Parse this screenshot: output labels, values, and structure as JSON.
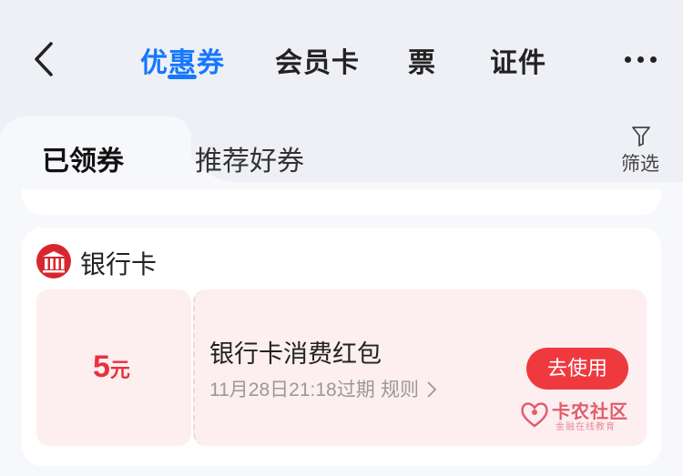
{
  "nav": {
    "tabs": [
      {
        "label": "优惠券",
        "active": true
      },
      {
        "label": "会员卡",
        "active": false
      },
      {
        "label": "票",
        "active": false
      },
      {
        "label": "证件",
        "active": false
      }
    ]
  },
  "subtabs": {
    "items": [
      {
        "label": "已领券",
        "active": true
      },
      {
        "label": "推荐好券",
        "active": false
      }
    ],
    "filter_label": "筛选"
  },
  "section": {
    "bank_name": "银行卡",
    "coupon": {
      "amount": "5",
      "unit": "元",
      "title": "银行卡消费红包",
      "expiry": "11月28日21:18过期",
      "rules_label": "规则",
      "use_button": "去使用"
    }
  },
  "watermark": {
    "title": "卡农社区",
    "subtitle": "金融在线教育"
  },
  "colors": {
    "accent": "#1677ff",
    "coupon_red": "#e8323c",
    "button_red": "#ee3a3e",
    "coupon_bg": "#fdeef0"
  }
}
